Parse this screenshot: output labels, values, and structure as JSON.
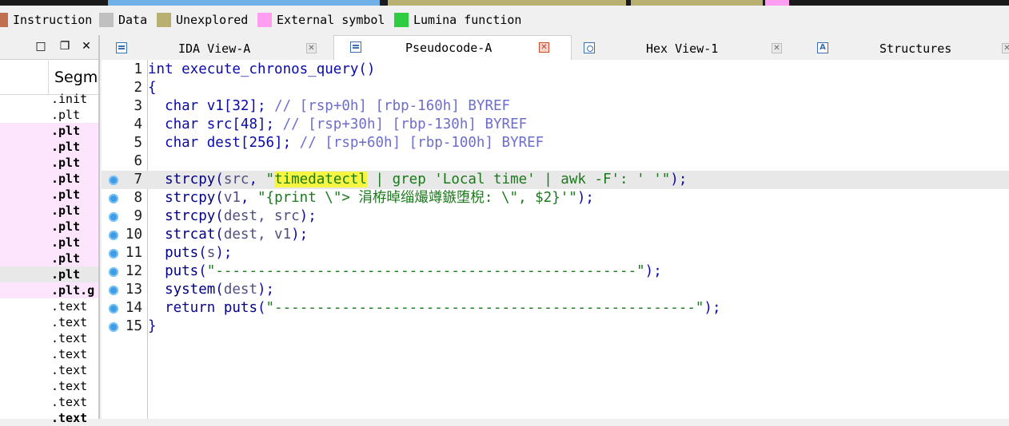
{
  "legend": {
    "items": [
      {
        "label": "Instruction",
        "color": "#c07050"
      },
      {
        "label": "Data",
        "color": "#c0c0c0"
      },
      {
        "label": "Unexplored",
        "color": "#b8b070"
      },
      {
        "label": "External symbol",
        "color": "#ff9ef0"
      },
      {
        "label": "Lumina function",
        "color": "#2ecc40"
      }
    ]
  },
  "segments_panel": {
    "header": "Segme",
    "rows": [
      ".init",
      ".plt",
      ".plt",
      ".plt",
      ".plt",
      ".plt",
      ".plt",
      ".plt",
      ".plt",
      ".plt",
      ".plt",
      ".plt",
      ".plt.g",
      ".text",
      ".text",
      ".text",
      ".text",
      ".text",
      ".text",
      ".text",
      ".text"
    ]
  },
  "tabs": [
    {
      "label": "IDA View-A",
      "icon": "disasm-icon",
      "active": false
    },
    {
      "label": "Pseudocode-A",
      "icon": "pseudocode-icon",
      "active": true
    },
    {
      "label": "Hex View-1",
      "icon": "hex-icon",
      "active": false
    },
    {
      "label": "Structures",
      "icon": "structures-icon",
      "active": false
    }
  ],
  "code": {
    "line_numbers": [
      "1",
      "2",
      "3",
      "4",
      "5",
      "6",
      "7",
      "8",
      "9",
      "10",
      "11",
      "12",
      "13",
      "14",
      "15"
    ],
    "l1": "int execute_chronos_query()",
    "l2": "{",
    "l3_type": "char ",
    "l3_decl": "v1[32]; ",
    "l3_cmt": "// [rsp+0h] [rbp-160h] BYREF",
    "l4_type": "char ",
    "l4_decl": "src[48]; ",
    "l4_cmt": "// [rsp+30h] [rbp-130h] BYREF",
    "l5_type": "char ",
    "l5_decl": "dest[256]; ",
    "l5_cmt": "// [rsp+60h] [rbp-100h] BYREF",
    "l7_fn": "strcpy",
    "l7_arg": "src",
    "l7_hl": "timedatectl",
    "l7_rest": " | grep 'Local time' | awk -F': ' '",
    "l8_fn": "strcpy",
    "l8_arg": "v1",
    "l8_str": "\"{print \\\"> 涓栫晫缁熶竴鏃堕棿: \\\", $2}'\"",
    "l9_fn": "strcpy",
    "l9_args": "dest, src",
    "l10_fn": "strcat",
    "l10_args": "dest, v1",
    "l11_fn": "puts",
    "l11_arg": "s",
    "l12_fn": "puts",
    "l12_str": "\"--------------------------------------------------\"",
    "l13_fn": "system",
    "l13_arg": "dest",
    "l14_kw": "return ",
    "l14_fn": "puts",
    "l14_str": "\"--------------------------------------------------\"",
    "l15": "}"
  }
}
